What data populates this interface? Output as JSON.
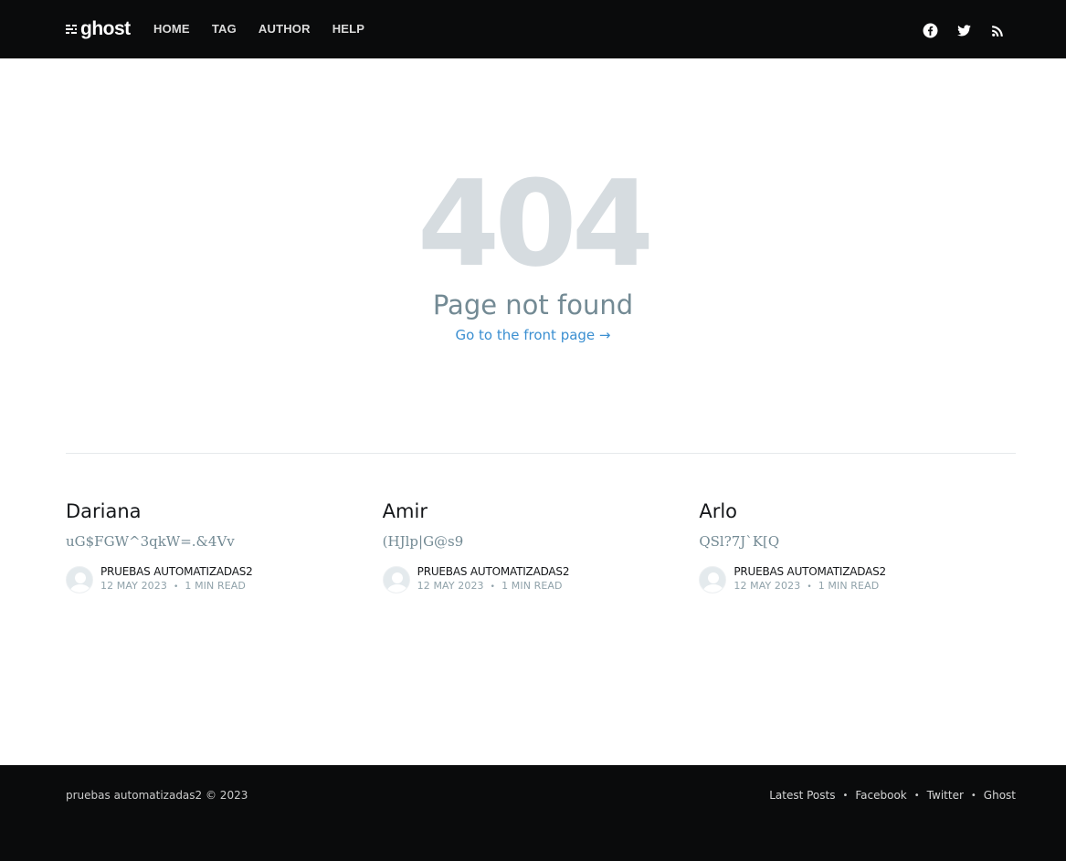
{
  "header": {
    "logo_text": "ghost",
    "nav": [
      {
        "label": "HOME"
      },
      {
        "label": "TAG"
      },
      {
        "label": "AUTHOR"
      },
      {
        "label": "HELP"
      }
    ],
    "social_icons": [
      "facebook-icon",
      "twitter-icon",
      "rss-icon"
    ]
  },
  "error": {
    "code": "404",
    "description": "Page not found",
    "link_label": "Go to the front page →"
  },
  "posts": [
    {
      "title": "Dariana",
      "excerpt": "uG$FGW^3qkW=.&4Vv",
      "author": "PRUEBAS AUTOMATIZADAS2",
      "date": "12 MAY 2023",
      "read_time": "1 MIN READ"
    },
    {
      "title": "Amir",
      "excerpt": "(HJlp|G@s9",
      "author": "PRUEBAS AUTOMATIZADAS2",
      "date": "12 MAY 2023",
      "read_time": "1 MIN READ"
    },
    {
      "title": "Arlo",
      "excerpt": "QSl?7J`K[Q",
      "author": "PRUEBAS AUTOMATIZADAS2",
      "date": "12 MAY 2023",
      "read_time": "1 MIN READ"
    }
  ],
  "footer": {
    "copyright": "pruebas automatizadas2 © 2023",
    "links": [
      {
        "label": "Latest Posts"
      },
      {
        "label": "Facebook"
      },
      {
        "label": "Twitter"
      },
      {
        "label": "Ghost"
      }
    ]
  },
  "colors": {
    "header_bg": "#0a0b0c",
    "error_code": "#d6dce0",
    "muted_text": "#738a94",
    "link": "#3b8fd1"
  }
}
